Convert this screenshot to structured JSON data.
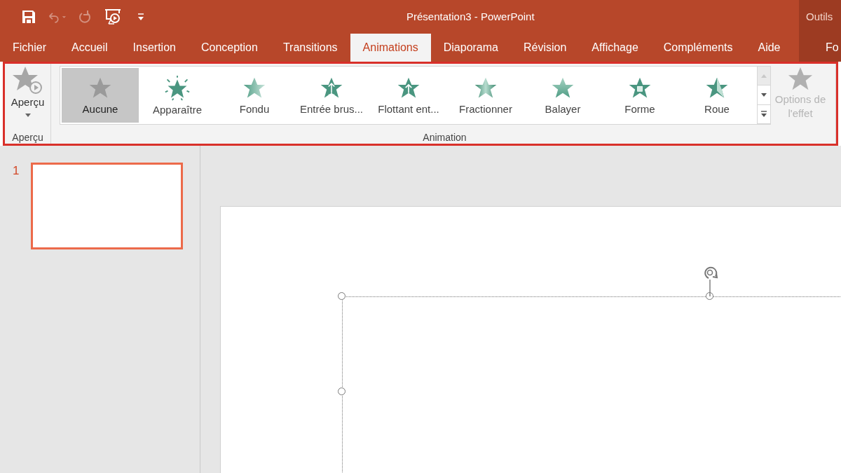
{
  "quick_access": [
    {
      "kind": "save",
      "disabled": false
    },
    {
      "kind": "undo",
      "disabled": true
    },
    {
      "kind": "redo",
      "disabled": true
    },
    {
      "kind": "slideshow",
      "disabled": false
    },
    {
      "kind": "customize",
      "disabled": false
    }
  ],
  "window": {
    "title": "Présentation3 - PowerPoint"
  },
  "tabs": [
    {
      "label": "Fichier",
      "selected": false
    },
    {
      "label": "Accueil",
      "selected": false
    },
    {
      "label": "Insertion",
      "selected": false
    },
    {
      "label": "Conception",
      "selected": false
    },
    {
      "label": "Transitions",
      "selected": false
    },
    {
      "label": "Animations",
      "selected": true
    },
    {
      "label": "Diaporama",
      "selected": false
    },
    {
      "label": "Révision",
      "selected": false
    },
    {
      "label": "Affichage",
      "selected": false
    },
    {
      "label": "Compléments",
      "selected": false
    },
    {
      "label": "Aide",
      "selected": false
    }
  ],
  "contextual_tabs": {
    "title": "Outils",
    "tabs": [
      {
        "label": "Fo",
        "selected": false
      }
    ]
  },
  "ribbon": {
    "preview_group": {
      "button": "Aperçu",
      "label": "Aperçu"
    },
    "animation_group": {
      "label": "Animation",
      "gallery": [
        {
          "label": "Aucune",
          "selected": true
        },
        {
          "label": "Apparaître",
          "selected": false
        },
        {
          "label": "Fondu",
          "selected": false
        },
        {
          "label": "Entrée brus...",
          "selected": false
        },
        {
          "label": "Flottant ent...",
          "selected": false
        },
        {
          "label": "Fractionner",
          "selected": false
        },
        {
          "label": "Balayer",
          "selected": false
        },
        {
          "label": "Forme",
          "selected": false
        },
        {
          "label": "Roue",
          "selected": false
        }
      ],
      "effect_options": {
        "label": "Options de l'effet",
        "disabled": true
      }
    }
  },
  "slides_pane": [
    {
      "number": "1",
      "selected": true
    }
  ]
}
